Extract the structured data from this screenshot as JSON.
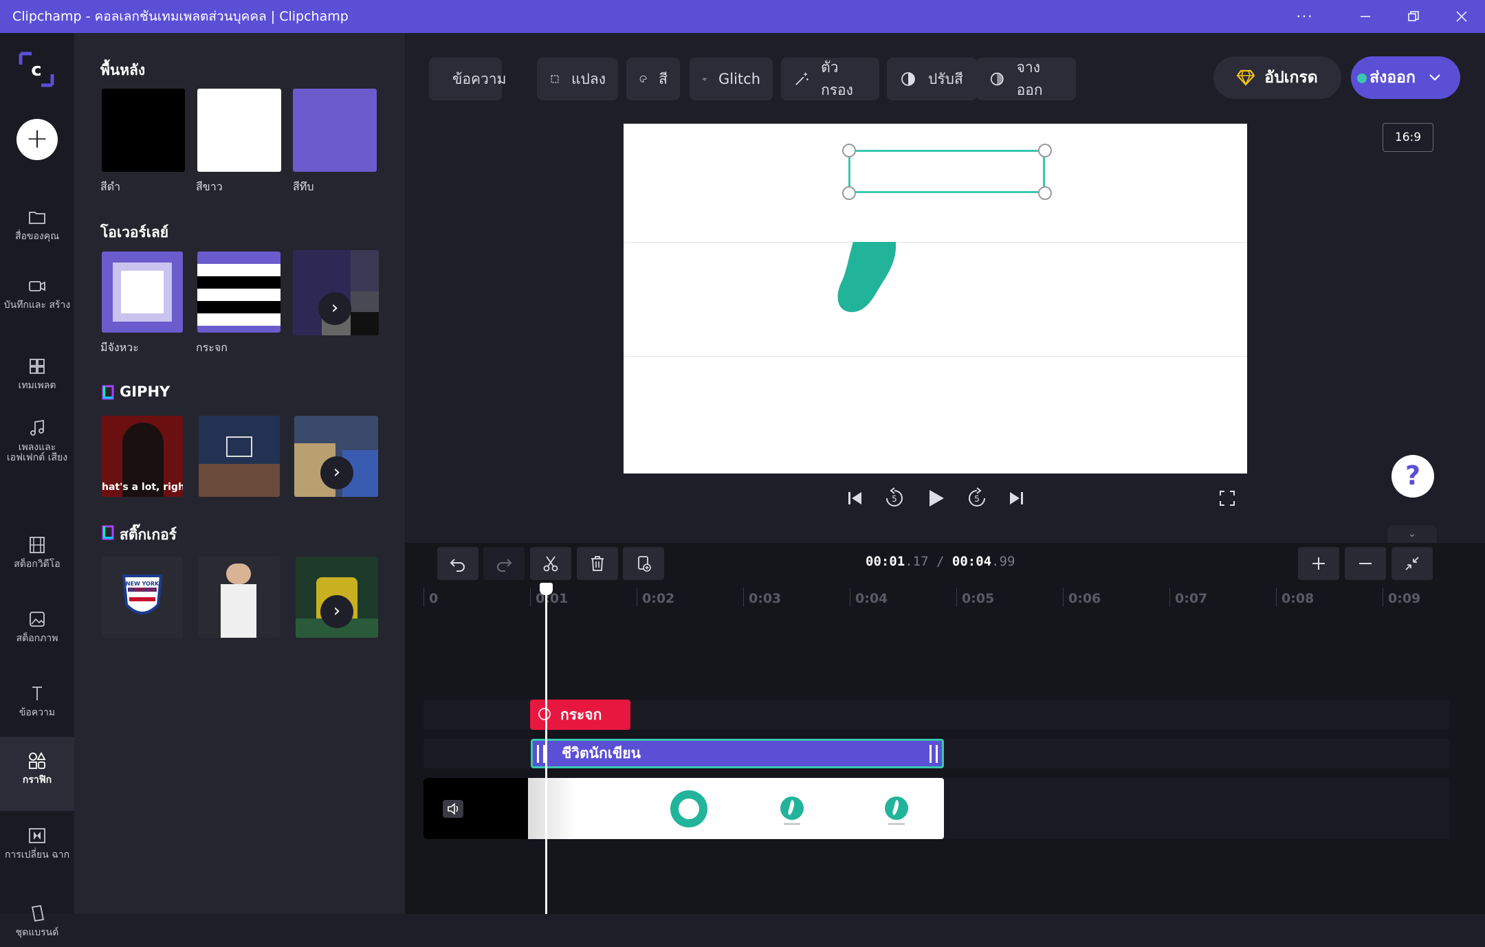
{
  "window": {
    "title": "Clipchamp - คอลเลกชันเทมเพลตส่วนบุคคล | Clipchamp",
    "more_label": "···"
  },
  "rail": {
    "items": [
      {
        "label": "สื่อของคุณ"
      },
      {
        "label": "บันทึกและ สร้าง"
      },
      {
        "label": "เทมเพลต"
      },
      {
        "label": "เพลงและ เอฟเฟกต์ เสียง"
      },
      {
        "label": "สต็อกวิดีโอ"
      },
      {
        "label": "สต็อกภาพ"
      },
      {
        "label": "ข้อความ"
      },
      {
        "label": "กราฟิก"
      },
      {
        "label": "การเปลี่ยน ฉาก"
      },
      {
        "label": "ชุดแบรนด์"
      }
    ]
  },
  "panel": {
    "backgrounds": {
      "title": "พื้นหลัง",
      "items": [
        {
          "label": "สีดำ",
          "color": "#000000"
        },
        {
          "label": "สีขาว",
          "color": "#ffffff"
        },
        {
          "label": "สีทึบ",
          "color": "#6a5ccc"
        }
      ]
    },
    "overlays": {
      "title": "โอเวอร์เลย์",
      "items": [
        {
          "label": "มีจังหวะ"
        },
        {
          "label": "กระจก"
        }
      ]
    },
    "giphy": {
      "title": "GIPHY",
      "caption": "hat's a lot, righ"
    },
    "stickers": {
      "title": "สติ๊กเกอร์",
      "sticker_text": "NEW YORK RANGERS"
    }
  },
  "toolbar": {
    "text": "ข้อความ",
    "transform": "แปลง",
    "color": "สี",
    "glitch": "Glitch",
    "filter": "ตัวกรอง",
    "adjust": "ปรับสี",
    "fade": "จางออก"
  },
  "upgrade_label": "อัปเกรด",
  "export_label": "ส่งออก",
  "ratio_label": "16:9",
  "help_label": "?",
  "timecode": {
    "current_main": "00:01",
    "current_frac": ".17",
    "separator": "/",
    "total_main": "00:04",
    "total_frac": ".99"
  },
  "ruler": [
    "0",
    "0:01",
    "0:02",
    "0:03",
    "0:04",
    "0:05",
    "0:06",
    "0:07",
    "0:08",
    "0:09"
  ],
  "tracks": {
    "overlay_clip": "กระจก",
    "text_clip": "ชีวิตนักเขียน"
  },
  "colors": {
    "accent": "#5b4fd6",
    "teal": "#38c8b0",
    "red": "#e8173f"
  }
}
